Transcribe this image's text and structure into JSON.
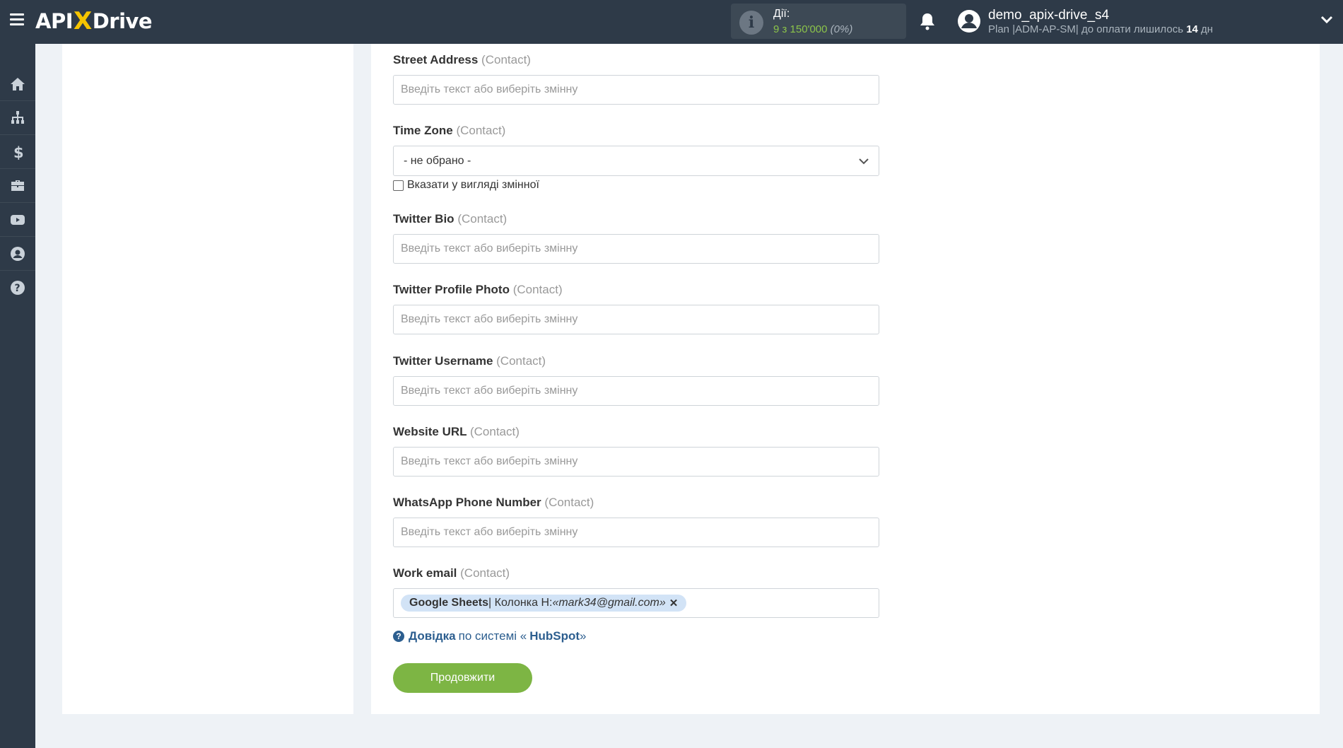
{
  "app": {
    "logo_left": "API",
    "logo_x": "X",
    "logo_right": "Drive"
  },
  "header": {
    "actions_title": "Дії:",
    "actions_value": "9 з 150'000",
    "actions_percent": "(0%)",
    "user_name": "demo_apix-drive_s4",
    "plan_text": "Plan |ADM-AP-SM| до оплати лишилось",
    "plan_days": "14",
    "plan_unit": "дн"
  },
  "sidebar": {
    "items": [
      {
        "icon": "home-icon"
      },
      {
        "icon": "sitemap-icon"
      },
      {
        "icon": "dollar-icon"
      },
      {
        "icon": "briefcase-icon"
      },
      {
        "icon": "youtube-icon"
      },
      {
        "icon": "user-circle-icon"
      },
      {
        "icon": "question-circle-icon"
      }
    ]
  },
  "form": {
    "context": "(Contact)",
    "placeholder": "Введіть текст або виберіть змінну",
    "fields": [
      {
        "label": "Street Address"
      },
      {
        "label": "Time Zone",
        "select_value": "- не обрано -",
        "checkbox_label": "Вказати у вигляді змінної"
      },
      {
        "label": "Twitter Bio"
      },
      {
        "label": "Twitter Profile Photo"
      },
      {
        "label": "Twitter Username"
      },
      {
        "label": "Website URL"
      },
      {
        "label": "WhatsApp Phone Number"
      },
      {
        "label": "Work email",
        "tag_source": "Google Sheets",
        "tag_column": " | Колонка H: ",
        "tag_value": "«mark34@gmail.com»"
      }
    ]
  },
  "help": {
    "link_text": "Довідка",
    "middle": "по системі «",
    "system": "HubSpot",
    "end": "»"
  },
  "buttons": {
    "continue": "Продовжити"
  },
  "colors": {
    "topbar": "#2e3a48",
    "accent_green": "#7db544",
    "link_blue": "#2c5e8f",
    "logo_yellow": "#f5c400"
  }
}
